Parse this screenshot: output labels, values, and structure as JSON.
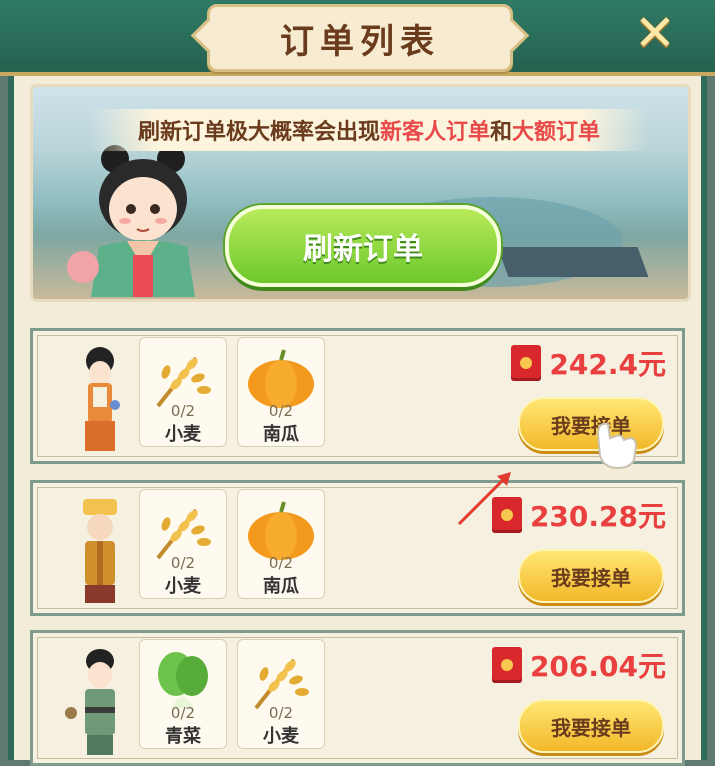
{
  "header": {
    "title": "订单列表",
    "close_label": "✕"
  },
  "banner": {
    "text_prefix": "刷新订单极大概率会出现",
    "highlight1": "新客人订单",
    "text_mid": "和",
    "highlight2": "大额订单",
    "refresh_button": "刷新订单"
  },
  "orders": [
    {
      "items": [
        {
          "icon": "wheat-icon",
          "qty": "0/2",
          "name": "小麦"
        },
        {
          "icon": "pumpkin-icon",
          "qty": "0/2",
          "name": "南瓜"
        }
      ],
      "price": "242.4元",
      "button": "我要接单"
    },
    {
      "items": [
        {
          "icon": "wheat-icon",
          "qty": "0/2",
          "name": "小麦"
        },
        {
          "icon": "pumpkin-icon",
          "qty": "0/2",
          "name": "南瓜"
        }
      ],
      "price": "230.28元",
      "button": "我要接单"
    },
    {
      "items": [
        {
          "icon": "bokchoy-icon",
          "qty": "0/2",
          "name": "青菜"
        },
        {
          "icon": "wheat-icon",
          "qty": "0/2",
          "name": "小麦"
        }
      ],
      "price": "206.04元",
      "button": "我要接单"
    }
  ],
  "colors": {
    "accent_green": "#2f7a66",
    "price_red": "#ea3f3f",
    "button_gold": "#f3b82a",
    "refresh_green": "#6ec82c"
  }
}
